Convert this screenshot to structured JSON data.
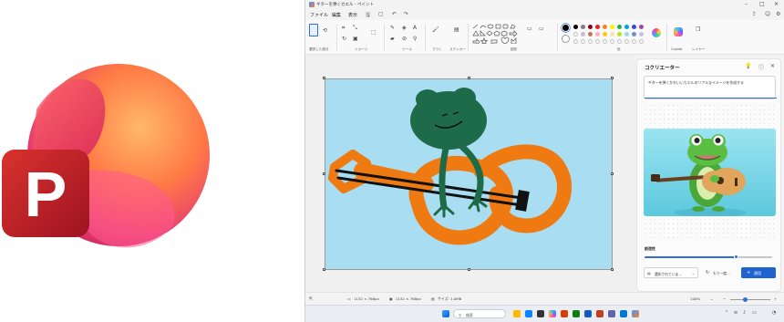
{
  "window": {
    "title": "ギターを弾くカエル - ペイント"
  },
  "menu": {
    "file": "ファイル",
    "edit": "編集",
    "view": "表示"
  },
  "ribbon": {
    "groups": {
      "selection": "選択した部分",
      "image": "イメージ",
      "tools": "ツール",
      "brushes": "ブラシ",
      "shapes": "図形",
      "colors": "色",
      "copilot": "Copilot",
      "layers": "レイヤー",
      "sticker": "ステッカー"
    },
    "palette_row1": [
      "#000000",
      "#7f7f7f",
      "#880015",
      "#ed1c24",
      "#ff7f27",
      "#fff200",
      "#22b14c",
      "#00a2e8",
      "#3f48cc",
      "#a349a4"
    ],
    "palette_row2": [
      "#ffffff",
      "#c3c3c3",
      "#b97a57",
      "#ffaec9",
      "#ffc90e",
      "#efe4b0",
      "#b5e61d",
      "#99d9ea",
      "#7092be",
      "#c8bfe7"
    ]
  },
  "cocreator": {
    "title": "コクリエーター",
    "prompt": "ギターを弾くかわいいカエルのリアルなイメージを作成する",
    "creativity_label": "創造性",
    "creativity_value": 0.72,
    "style_select": "選択されていま...",
    "retry_label": "もう一度...",
    "apply_label": "適用"
  },
  "statusbar": {
    "canvas_size_1": "1152 × 768px",
    "canvas_size_2": "1152 × 768px",
    "file_size": "サイズ: 1.0MB",
    "zoom": "100%"
  },
  "taskbar": {
    "search": "検索"
  },
  "colors": {
    "accent": "#1f63d1",
    "canvas_bg": "#a9def2",
    "frog_green": "#1e6b4a",
    "guitar_orange": "#f07a12"
  }
}
